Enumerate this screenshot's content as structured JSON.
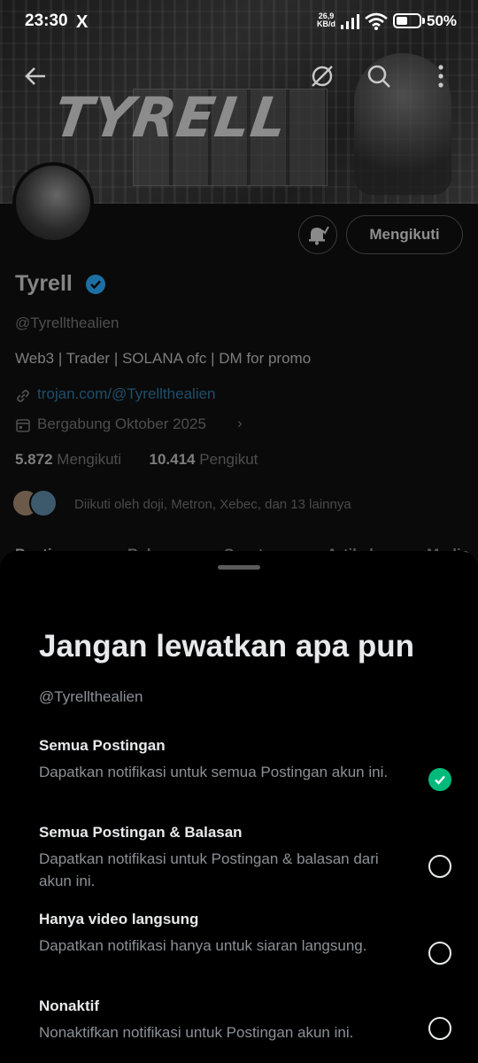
{
  "status_bar": {
    "time": "23:30",
    "app_glyph": "X",
    "net_speed_value": "26,9",
    "net_speed_unit": "KB/d",
    "battery_percent": "50%",
    "battery_level": 0.5
  },
  "profile": {
    "banner_text": "TYRELL",
    "name": "Tyrell",
    "handle": "@Tyrellthealien",
    "bio": "Web3 | Trader | SOLANA ofc | DM for promo",
    "link": "trojan.com/@Tyrellthealien",
    "joined": "Bergabung Oktober 2025",
    "following_count": "5.872",
    "following_label": "Mengikuti",
    "followers_count": "10.414",
    "followers_label": "Pengikut",
    "followed_by": "Diikuti oleh doji, Metron, Xebec, dan 13 lainnya",
    "follow_button": "Mengikuti",
    "tabs": [
      "Postingan",
      "Balasan",
      "Sorotan",
      "Artikel",
      "Media"
    ]
  },
  "sheet": {
    "title": "Jangan lewatkan apa pun",
    "handle": "@Tyrellthealien",
    "options": [
      {
        "title": "Semua Postingan",
        "desc": "Dapatkan notifikasi untuk semua Postingan akun ini.",
        "selected": true
      },
      {
        "title": "Semua Postingan & Balasan",
        "desc": "Dapatkan notifikasi untuk Postingan & balasan dari akun ini.",
        "selected": false
      },
      {
        "title": "Hanya video langsung",
        "desc": "Dapatkan notifikasi hanya untuk siaran langsung.",
        "selected": false
      },
      {
        "title": "Nonaktif",
        "desc": "Nonaktifkan notifikasi untuk Postingan akun ini.",
        "selected": false
      }
    ]
  },
  "colors": {
    "accent_green": "#00ba7c",
    "verified_blue": "#1d9bf0",
    "text_primary": "#e7e9ea",
    "text_secondary": "#8b9196"
  }
}
